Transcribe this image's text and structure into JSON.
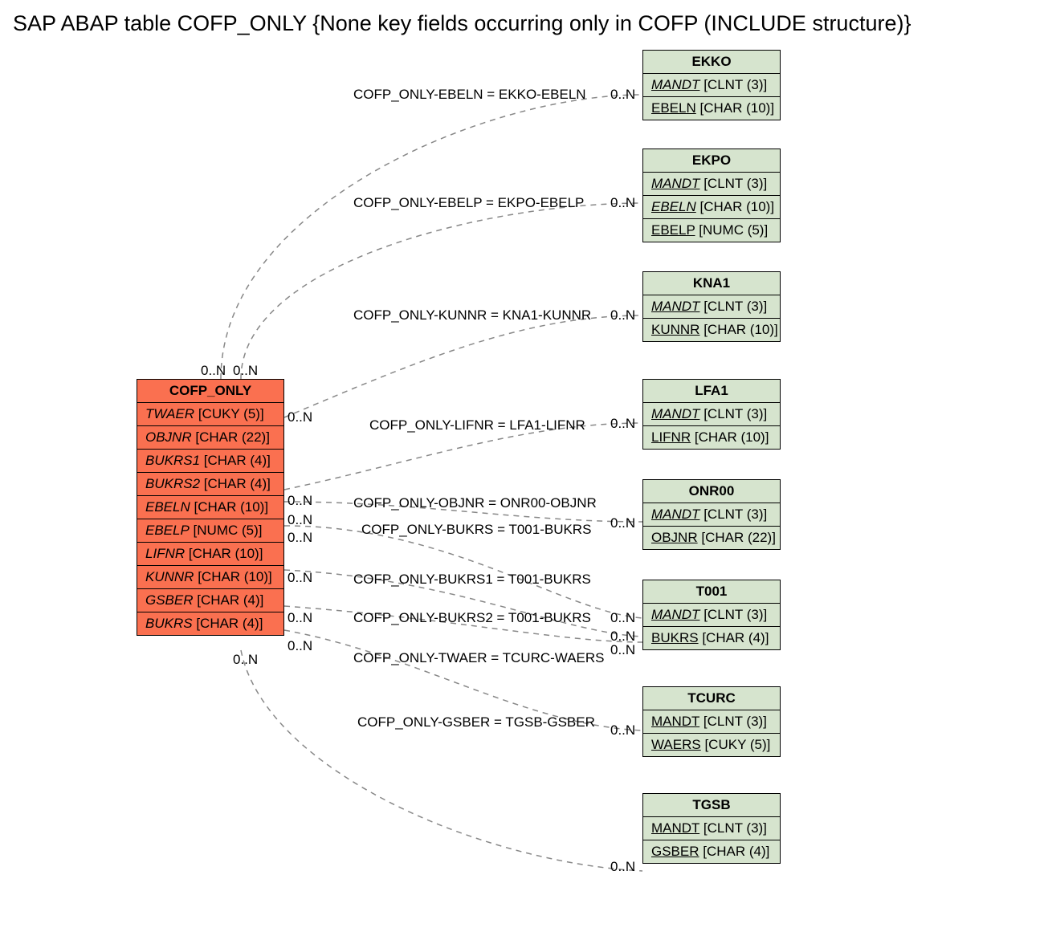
{
  "title": "SAP ABAP table COFP_ONLY {None key fields occurring only in COFP (INCLUDE structure)}",
  "main": {
    "name": "COFP_ONLY",
    "fields": [
      {
        "n": "TWAER",
        "t": "[CUKY (5)]"
      },
      {
        "n": "OBJNR",
        "t": "[CHAR (22)]"
      },
      {
        "n": "BUKRS1",
        "t": "[CHAR (4)]"
      },
      {
        "n": "BUKRS2",
        "t": "[CHAR (4)]"
      },
      {
        "n": "EBELN",
        "t": "[CHAR (10)]"
      },
      {
        "n": "EBELP",
        "t": "[NUMC (5)]"
      },
      {
        "n": "LIFNR",
        "t": "[CHAR (10)]"
      },
      {
        "n": "KUNNR",
        "t": "[CHAR (10)]"
      },
      {
        "n": "GSBER",
        "t": "[CHAR (4)]"
      },
      {
        "n": "BUKRS",
        "t": "[CHAR (4)]"
      }
    ]
  },
  "related": [
    {
      "name": "EKKO",
      "fields": [
        {
          "n": "MANDT",
          "t": "[CLNT (3)]",
          "i": true
        },
        {
          "n": "EBELN",
          "t": "[CHAR (10)]"
        }
      ]
    },
    {
      "name": "EKPO",
      "fields": [
        {
          "n": "MANDT",
          "t": "[CLNT (3)]",
          "i": true
        },
        {
          "n": "EBELN",
          "t": "[CHAR (10)]",
          "i": true
        },
        {
          "n": "EBELP",
          "t": "[NUMC (5)]"
        }
      ]
    },
    {
      "name": "KNA1",
      "fields": [
        {
          "n": "MANDT",
          "t": "[CLNT (3)]",
          "i": true
        },
        {
          "n": "KUNNR",
          "t": "[CHAR (10)]"
        }
      ]
    },
    {
      "name": "LFA1",
      "fields": [
        {
          "n": "MANDT",
          "t": "[CLNT (3)]",
          "i": true
        },
        {
          "n": "LIFNR",
          "t": "[CHAR (10)]"
        }
      ]
    },
    {
      "name": "ONR00",
      "fields": [
        {
          "n": "MANDT",
          "t": "[CLNT (3)]",
          "i": true
        },
        {
          "n": "OBJNR",
          "t": "[CHAR (22)]"
        }
      ]
    },
    {
      "name": "T001",
      "fields": [
        {
          "n": "MANDT",
          "t": "[CLNT (3)]",
          "i": true
        },
        {
          "n": "BUKRS",
          "t": "[CHAR (4)]"
        }
      ]
    },
    {
      "name": "TCURC",
      "fields": [
        {
          "n": "MANDT",
          "t": "[CLNT (3)]"
        },
        {
          "n": "WAERS",
          "t": "[CUKY (5)]"
        }
      ]
    },
    {
      "name": "TGSB",
      "fields": [
        {
          "n": "MANDT",
          "t": "[CLNT (3)]"
        },
        {
          "n": "GSBER",
          "t": "[CHAR (4)]"
        }
      ]
    }
  ],
  "links": [
    {
      "text": "COFP_ONLY-EBELN = EKKO-EBELN"
    },
    {
      "text": "COFP_ONLY-EBELP = EKPO-EBELP"
    },
    {
      "text": "COFP_ONLY-KUNNR = KNA1-KUNNR"
    },
    {
      "text": "COFP_ONLY-LIFNR = LFA1-LIFNR"
    },
    {
      "text": "COFP_ONLY-OBJNR = ONR00-OBJNR"
    },
    {
      "text": "COFP_ONLY-BUKRS = T001-BUKRS"
    },
    {
      "text": "COFP_ONLY-BUKRS1 = T001-BUKRS"
    },
    {
      "text": "COFP_ONLY-BUKRS2 = T001-BUKRS"
    },
    {
      "text": "COFP_ONLY-TWAER = TCURC-WAERS"
    },
    {
      "text": "COFP_ONLY-GSBER = TGSB-GSBER"
    }
  ],
  "card": "0..N"
}
